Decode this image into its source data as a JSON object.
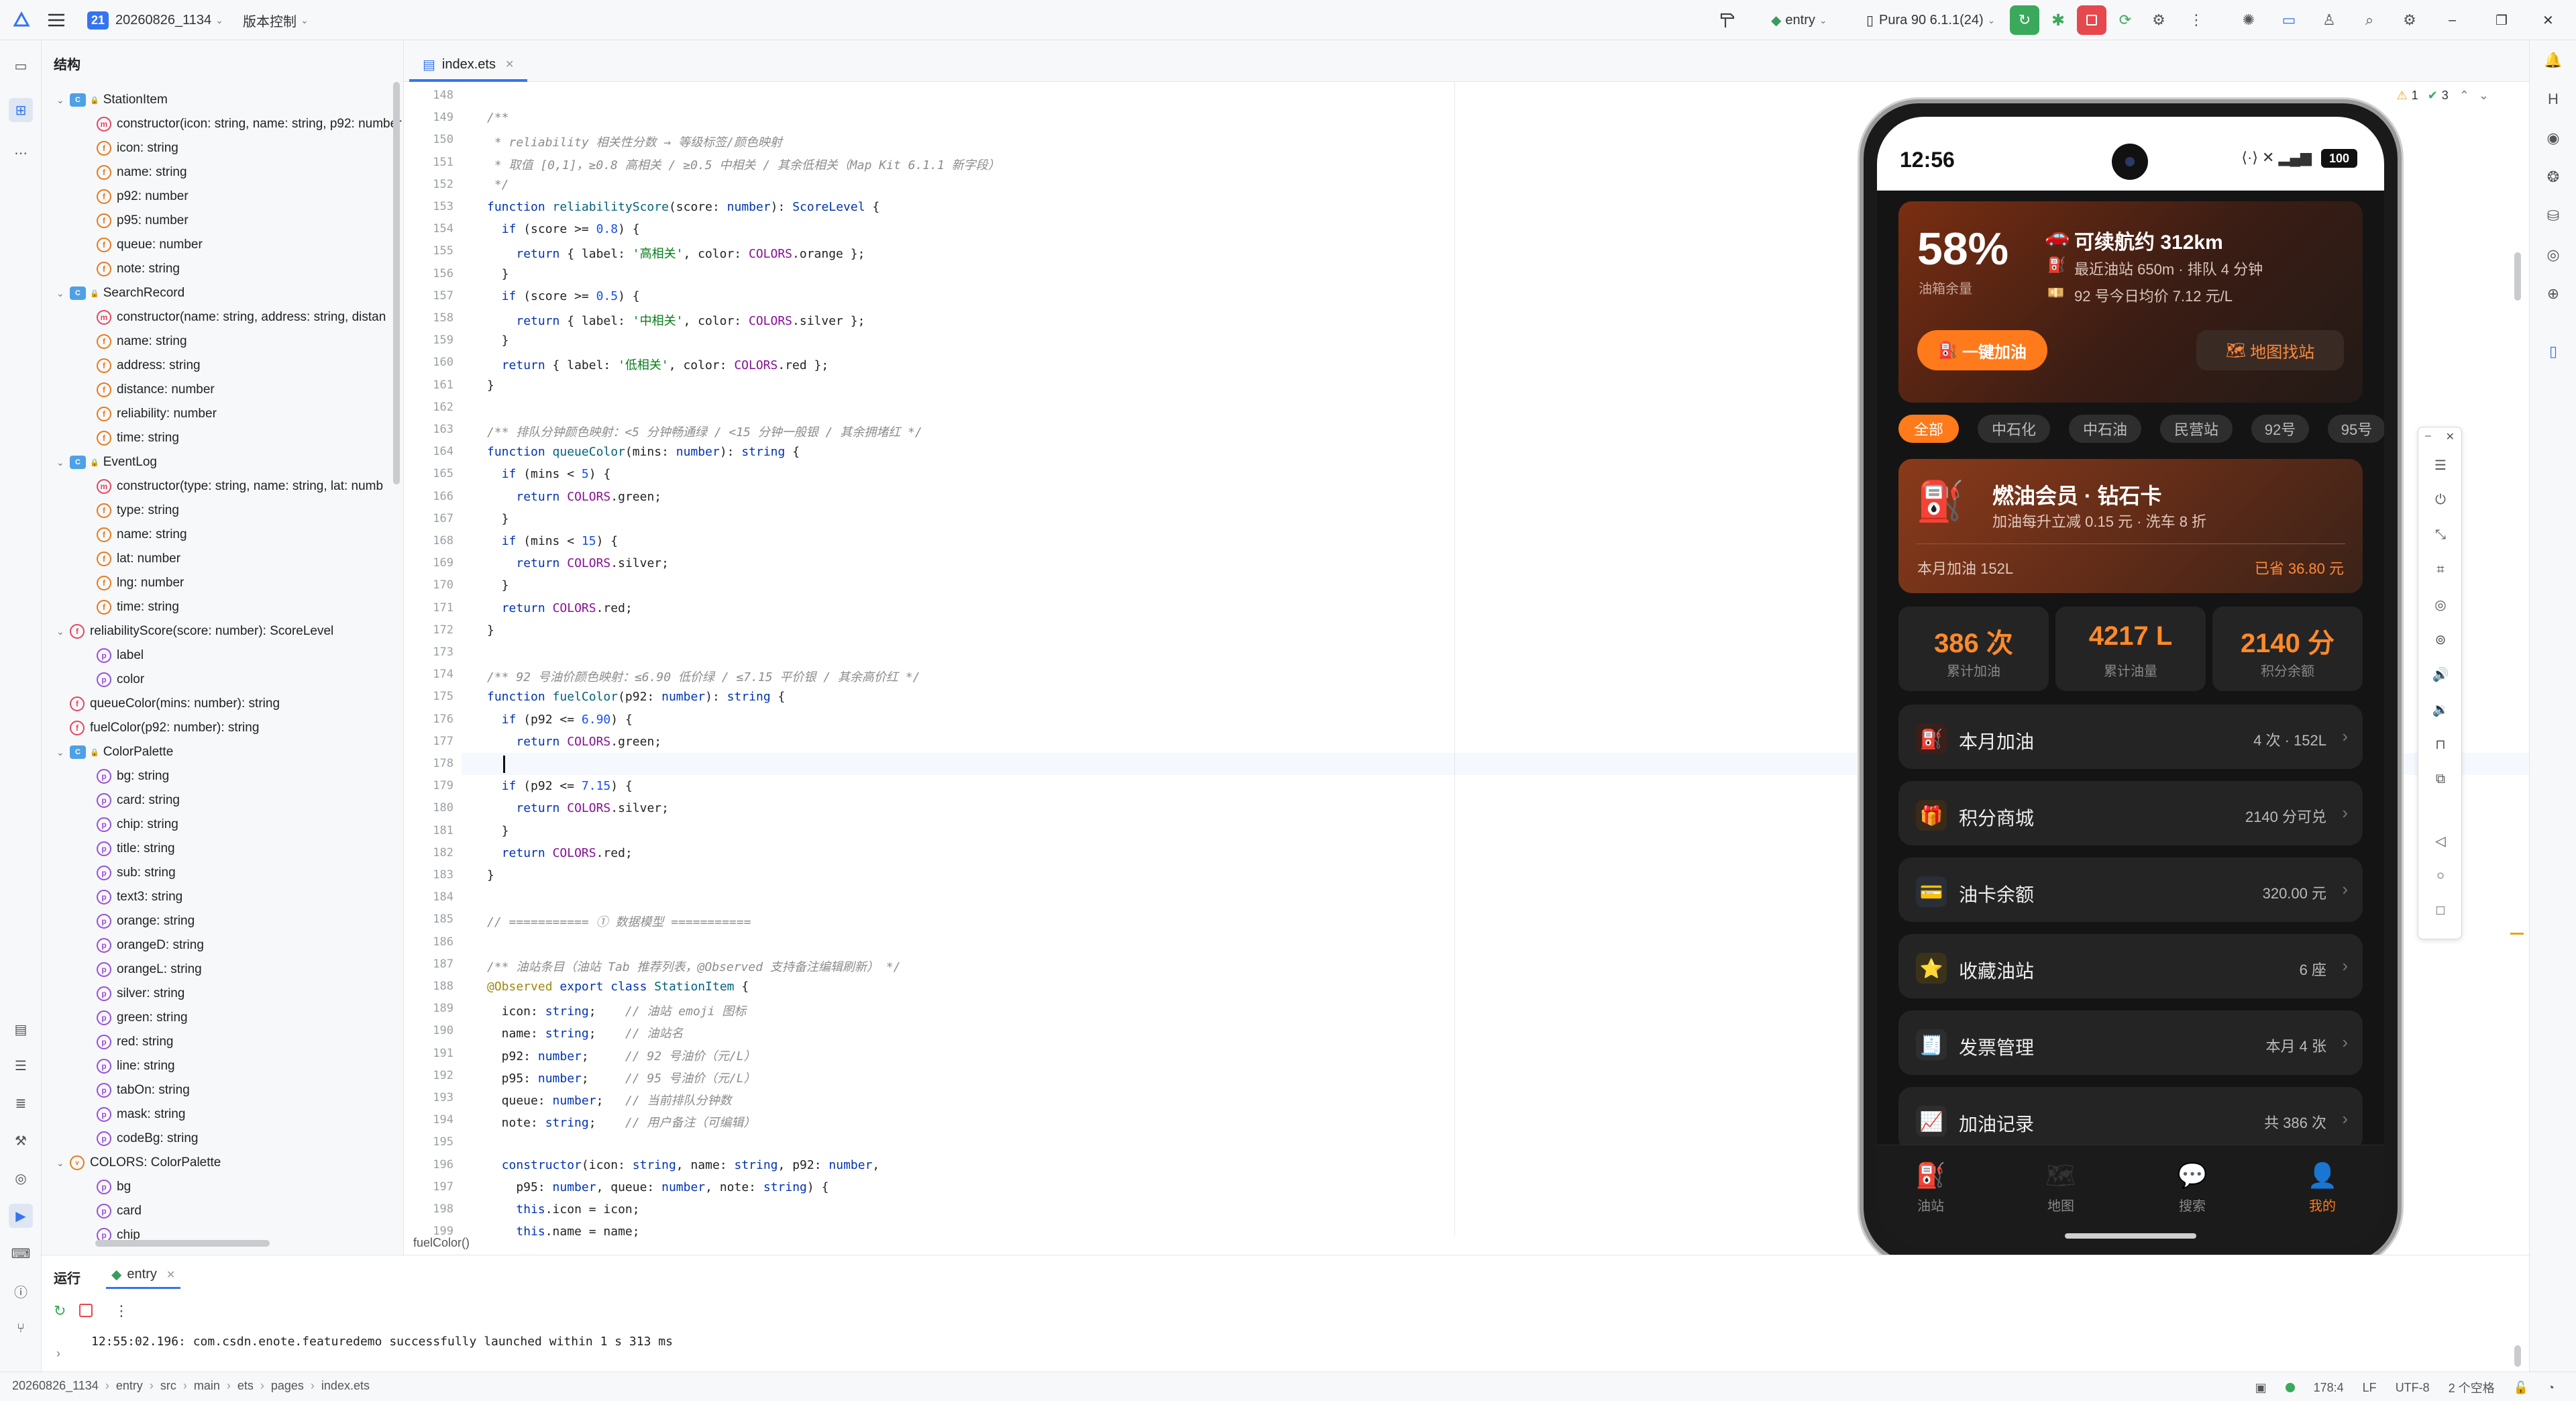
{
  "titlebar": {
    "project_num": "21",
    "project_name": "20260826_1134",
    "vcs_label": "版本控制",
    "module": "entry",
    "device": "Pura 90 6.1.1(24)"
  },
  "structure": {
    "title": "结构",
    "rows": [
      {
        "label": "StationItem",
        "kind": "class",
        "indent": 0,
        "chev": "v"
      },
      {
        "label": "constructor(icon: string, name: string, p92: number",
        "kind": "method",
        "indent": 1
      },
      {
        "label": "icon: string",
        "kind": "field",
        "indent": 1
      },
      {
        "label": "name: string",
        "kind": "field",
        "indent": 1
      },
      {
        "label": "p92: number",
        "kind": "field",
        "indent": 1
      },
      {
        "label": "p95: number",
        "kind": "field",
        "indent": 1
      },
      {
        "label": "queue: number",
        "kind": "field",
        "indent": 1
      },
      {
        "label": "note: string",
        "kind": "field",
        "indent": 1
      },
      {
        "label": "SearchRecord",
        "kind": "class",
        "indent": 0,
        "chev": "v"
      },
      {
        "label": "constructor(name: string, address: string, distan",
        "kind": "method",
        "indent": 1
      },
      {
        "label": "name: string",
        "kind": "field",
        "indent": 1
      },
      {
        "label": "address: string",
        "kind": "field",
        "indent": 1
      },
      {
        "label": "distance: number",
        "kind": "field",
        "indent": 1
      },
      {
        "label": "reliability: number",
        "kind": "field",
        "indent": 1
      },
      {
        "label": "time: string",
        "kind": "field",
        "indent": 1
      },
      {
        "label": "EventLog",
        "kind": "class",
        "indent": 0,
        "chev": "v"
      },
      {
        "label": "constructor(type: string, name: string, lat: numb",
        "kind": "method",
        "indent": 1
      },
      {
        "label": "type: string",
        "kind": "field",
        "indent": 1
      },
      {
        "label": "name: string",
        "kind": "field",
        "indent": 1
      },
      {
        "label": "lat: number",
        "kind": "field",
        "indent": 1
      },
      {
        "label": "lng: number",
        "kind": "field",
        "indent": 1
      },
      {
        "label": "time: string",
        "kind": "field",
        "indent": 1
      },
      {
        "label": "reliabilityScore(score: number): ScoreLevel",
        "kind": "func",
        "indent": 0,
        "chev": "v"
      },
      {
        "label": "label",
        "kind": "prop",
        "indent": 1
      },
      {
        "label": "color",
        "kind": "prop",
        "indent": 1
      },
      {
        "label": "queueColor(mins: number): string",
        "kind": "func",
        "indent": 0
      },
      {
        "label": "fuelColor(p92: number): string",
        "kind": "func",
        "indent": 0
      },
      {
        "label": "ColorPalette",
        "kind": "class",
        "indent": 0,
        "chev": "v"
      },
      {
        "label": "bg: string",
        "kind": "prop",
        "indent": 1
      },
      {
        "label": "card: string",
        "kind": "prop",
        "indent": 1
      },
      {
        "label": "chip: string",
        "kind": "prop",
        "indent": 1
      },
      {
        "label": "title: string",
        "kind": "prop",
        "indent": 1
      },
      {
        "label": "sub: string",
        "kind": "prop",
        "indent": 1
      },
      {
        "label": "text3: string",
        "kind": "prop",
        "indent": 1
      },
      {
        "label": "orange: string",
        "kind": "prop",
        "indent": 1
      },
      {
        "label": "orangeD: string",
        "kind": "prop",
        "indent": 1
      },
      {
        "label": "orangeL: string",
        "kind": "prop",
        "indent": 1
      },
      {
        "label": "silver: string",
        "kind": "prop",
        "indent": 1
      },
      {
        "label": "green: string",
        "kind": "prop",
        "indent": 1
      },
      {
        "label": "red: string",
        "kind": "prop",
        "indent": 1
      },
      {
        "label": "line: string",
        "kind": "prop",
        "indent": 1
      },
      {
        "label": "tabOn: string",
        "kind": "prop",
        "indent": 1
      },
      {
        "label": "mask: string",
        "kind": "prop",
        "indent": 1
      },
      {
        "label": "codeBg: string",
        "kind": "prop",
        "indent": 1
      },
      {
        "label": "COLORS: ColorPalette",
        "kind": "var",
        "indent": 0,
        "chev": "v"
      },
      {
        "label": "bg",
        "kind": "prop",
        "indent": 1
      },
      {
        "label": "card",
        "kind": "prop",
        "indent": 1
      },
      {
        "label": "chip",
        "kind": "prop",
        "indent": 1
      }
    ]
  },
  "editor": {
    "tab_name": "index.ets",
    "warnings": "1",
    "checks": "3",
    "breadcrumb": "fuelColor()",
    "current_line": 178,
    "lines": [
      {
        "n": 148,
        "h": ""
      },
      {
        "n": 149,
        "h": "<span class=\"cm\">/**</span>"
      },
      {
        "n": 150,
        "h": "<span class=\"cm\"> * reliability 相关性分数 → 等级标签/颜色映射</span>"
      },
      {
        "n": 151,
        "h": "<span class=\"cm\"> * 取值 [0,1]，≥0.8 高相关 / ≥0.5 中相关 / 其余低相关（Map Kit 6.1.1 新字段）</span>"
      },
      {
        "n": 152,
        "h": "<span class=\"cm\"> */</span>"
      },
      {
        "n": 153,
        "h": "<span class=\"k\">function</span> <span class=\"fn\">reliabilityScore</span>(score: <span class=\"t\">number</span>): <span class=\"t\">ScoreLevel</span> {"
      },
      {
        "n": 154,
        "h": "  <span class=\"k\">if</span> (score >= <span class=\"nu\">0.8</span>) {"
      },
      {
        "n": 155,
        "h": "    <span class=\"k\">return</span> { label: <span class=\"st\">'高相关'</span>, color: <span class=\"pr\">COLORS</span>.orange };"
      },
      {
        "n": 156,
        "h": "  }"
      },
      {
        "n": 157,
        "h": "  <span class=\"k\">if</span> (score >= <span class=\"nu\">0.5</span>) {"
      },
      {
        "n": 158,
        "h": "    <span class=\"k\">return</span> { label: <span class=\"st\">'中相关'</span>, color: <span class=\"pr\">COLORS</span>.silver };"
      },
      {
        "n": 159,
        "h": "  }"
      },
      {
        "n": 160,
        "h": "  <span class=\"k\">return</span> { label: <span class=\"st\">'低相关'</span>, color: <span class=\"pr\">COLORS</span>.red };"
      },
      {
        "n": 161,
        "h": "}"
      },
      {
        "n": 162,
        "h": ""
      },
      {
        "n": 163,
        "h": "<span class=\"cm\">/** 排队分钟颜色映射：&lt;5 分钟畅通绿 / &lt;15 分钟一般银 / 其余拥堵红 */</span>"
      },
      {
        "n": 164,
        "h": "<span class=\"k\">function</span> <span class=\"fn\">queueColor</span>(mins: <span class=\"t\">number</span>): <span class=\"t\">string</span> {"
      },
      {
        "n": 165,
        "h": "  <span class=\"k\">if</span> (mins &lt; <span class=\"nu\">5</span>) {"
      },
      {
        "n": 166,
        "h": "    <span class=\"k\">return</span> <span class=\"pr\">COLORS</span>.green;"
      },
      {
        "n": 167,
        "h": "  }"
      },
      {
        "n": 168,
        "h": "  <span class=\"k\">if</span> (mins &lt; <span class=\"nu\">15</span>) {"
      },
      {
        "n": 169,
        "h": "    <span class=\"k\">return</span> <span class=\"pr\">COLORS</span>.silver;"
      },
      {
        "n": 170,
        "h": "  }"
      },
      {
        "n": 171,
        "h": "  <span class=\"k\">return</span> <span class=\"pr\">COLORS</span>.red;"
      },
      {
        "n": 172,
        "h": "}"
      },
      {
        "n": 173,
        "h": ""
      },
      {
        "n": 174,
        "h": "<span class=\"cm\">/** 92 号油价颜色映射：≤6.90 低价绿 / ≤7.15 平价银 / 其余高价红 */</span>"
      },
      {
        "n": 175,
        "h": "<span class=\"k\">function</span> <span class=\"fn\">fuelColor</span>(p92: <span class=\"t\">number</span>): <span class=\"t\">string</span> {"
      },
      {
        "n": 176,
        "h": "  <span class=\"k\">if</span> (p92 &lt;= <span class=\"nu\">6.90</span>) {"
      },
      {
        "n": 177,
        "h": "    <span class=\"k\">return</span> <span class=\"pr\">COLORS</span>.green;"
      },
      {
        "n": 178,
        "h": "  "
      },
      {
        "n": 179,
        "h": "  <span class=\"k\">if</span> (p92 &lt;= <span class=\"nu\">7.15</span>) {"
      },
      {
        "n": 180,
        "h": "    <span class=\"k\">return</span> <span class=\"pr\">COLORS</span>.silver;"
      },
      {
        "n": 181,
        "h": "  }"
      },
      {
        "n": 182,
        "h": "  <span class=\"k\">return</span> <span class=\"pr\">COLORS</span>.red;"
      },
      {
        "n": 183,
        "h": "}"
      },
      {
        "n": 184,
        "h": ""
      },
      {
        "n": 185,
        "h": "<span class=\"cm\">// =========== ① 数据模型 ===========</span>"
      },
      {
        "n": 186,
        "h": ""
      },
      {
        "n": 187,
        "h": "<span class=\"cm\">/** 油站条目（油站 Tab 推荐列表，@Observed 支持备注编辑刷新） */</span>"
      },
      {
        "n": 188,
        "h": "<span class=\"an\">@Observed</span> <span class=\"k\">export class</span> <span class=\"fn\">StationItem</span> {"
      },
      {
        "n": 189,
        "h": "  icon: <span class=\"t\">string</span>;    <span class=\"cm\">// 油站 emoji 图标</span>"
      },
      {
        "n": 190,
        "h": "  name: <span class=\"t\">string</span>;    <span class=\"cm\">// 油站名</span>"
      },
      {
        "n": 191,
        "h": "  p92: <span class=\"t\">number</span>;     <span class=\"cm\">// 92 号油价（元/L）</span>"
      },
      {
        "n": 192,
        "h": "  p95: <span class=\"t\">number</span>;     <span class=\"cm\">// 95 号油价（元/L）</span>"
      },
      {
        "n": 193,
        "h": "  queue: <span class=\"t\">number</span>;   <span class=\"cm\">// 当前排队分钟数</span>"
      },
      {
        "n": 194,
        "h": "  note: <span class=\"t\">string</span>;    <span class=\"cm\">// 用户备注（可编辑）</span>"
      },
      {
        "n": 195,
        "h": ""
      },
      {
        "n": 196,
        "h": "  <span class=\"k\">constructor</span>(icon: <span class=\"t\">string</span>, name: <span class=\"t\">string</span>, p92: <span class=\"t\">number</span>,"
      },
      {
        "n": 197,
        "h": "    p95: <span class=\"t\">number</span>, queue: <span class=\"t\">number</span>, note: <span class=\"t\">string</span>) {"
      },
      {
        "n": 198,
        "h": "    <span class=\"k\">this</span>.icon = icon;"
      },
      {
        "n": 199,
        "h": "    <span class=\"k\">this</span>.name = name;"
      }
    ]
  },
  "phone": {
    "time": "12:56",
    "battery": "100",
    "hero": {
      "percent": "58%",
      "percent_label": "油箱余量",
      "range": "可续航约 312km",
      "nearest": "最近油站 650m · 排队 4 分钟",
      "price": "92 号今日均价 7.12 元/L",
      "refuel_btn": "一键加油",
      "map_btn": "地图找站"
    },
    "filters": [
      "全部",
      "中石化",
      "中石油",
      "民营站",
      "92号",
      "95号"
    ],
    "member": {
      "title": "燃油会员 · 钻石卡",
      "sub": "加油每升立减 0.15 元 · 洗车 8 折",
      "month": "本月加油 152L",
      "saved": "已省 36.80 元"
    },
    "stats": [
      {
        "value": "386 次",
        "label": "累计加油"
      },
      {
        "value": "4217 L",
        "label": "累计油量"
      },
      {
        "value": "2140 分",
        "label": "积分余额"
      }
    ],
    "menu": [
      {
        "title": "本月加油",
        "right": "4 次 · 152L",
        "icon": "fuel-pump-icon",
        "glyph": "⛽",
        "bg": "#3a1f1a"
      },
      {
        "title": "积分商城",
        "right": "2140 分可兑",
        "icon": "gift-icon",
        "glyph": "🎁",
        "bg": "#3a2a1a"
      },
      {
        "title": "油卡余额",
        "right": "320.00 元",
        "icon": "credit-card-icon",
        "glyph": "💳",
        "bg": "#2a2e36"
      },
      {
        "title": "收藏油站",
        "right": "6 座",
        "icon": "star-icon",
        "glyph": "⭐",
        "bg": "#3a331a"
      },
      {
        "title": "发票管理",
        "right": "本月 4 张",
        "icon": "receipt-icon",
        "glyph": "🧾",
        "bg": "#2e2e2e"
      },
      {
        "title": "加油记录",
        "right": "共 386 次",
        "icon": "chart-icon",
        "glyph": "📈",
        "bg": "#2e2e2e"
      }
    ],
    "tabs": [
      {
        "label": "油站",
        "glyph": "⛽",
        "icon": "fuel-tab-icon"
      },
      {
        "label": "地图",
        "glyph": "🗺",
        "icon": "map-tab-icon"
      },
      {
        "label": "搜索",
        "glyph": "💬",
        "icon": "search-tab-icon"
      },
      {
        "label": "我的",
        "glyph": "👤",
        "icon": "profile-tab-icon"
      }
    ]
  },
  "run": {
    "label": "运行",
    "tab": "entry",
    "log": "12:55:02.196: com.csdn.enote.featuredemo successfully launched within 1 s 313 ms"
  },
  "status": {
    "path": [
      "20260826_1134",
      "entry",
      "src",
      "main",
      "ets",
      "pages",
      "index.ets"
    ],
    "position": "178:4",
    "line_sep": "LF",
    "encoding": "UTF-8",
    "indent": "2 个空格"
  },
  "colors": {
    "accent": "#3574f0",
    "orange": "#ff7a1a",
    "phone_bg": "#141414"
  }
}
